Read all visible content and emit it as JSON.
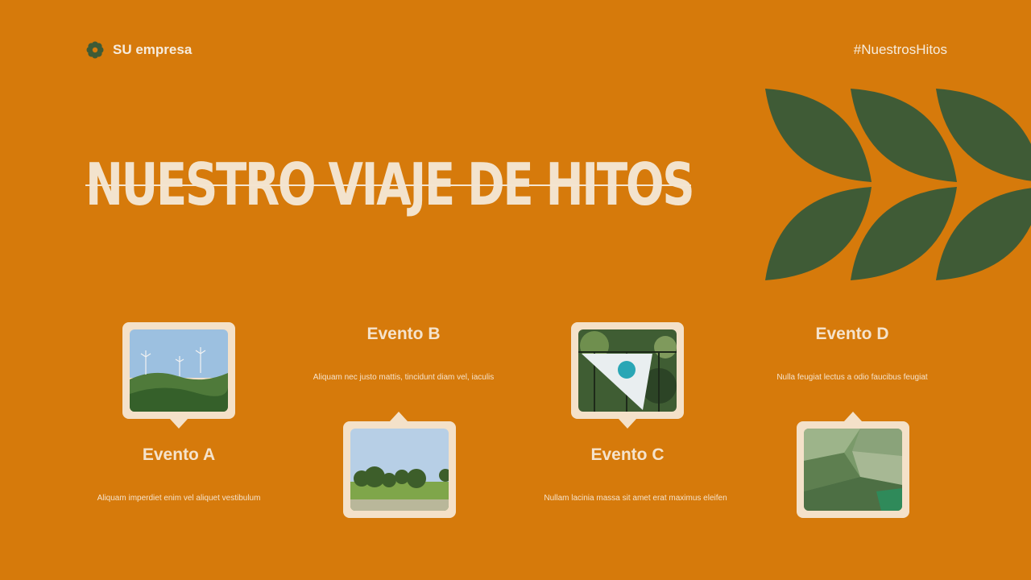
{
  "header": {
    "company": "SU empresa",
    "hashtag": "#NuestrosHitos",
    "logo_icon": "flower-icon"
  },
  "title": "NUESTRO VIAJE DE HITOS",
  "colors": {
    "background": "#d67a0b",
    "leaf": "#3f5b36",
    "card": "#f4e1c9",
    "text": "#f4e5d0"
  },
  "events": [
    {
      "title": "Evento A",
      "description": "Aliquam imperdiet enim vel aliquet vestibulum",
      "image": "wind-turbines-hills-photo"
    },
    {
      "title": "Evento B",
      "description": "Aliquam nec justo mattis, tincidunt diam vel, iaculis",
      "image": "trees-meadow-photo"
    },
    {
      "title": "Evento C",
      "description": "Nullam lacinia massa sit amet erat maximus eleifen",
      "image": "flag-banner-photo"
    },
    {
      "title": "Evento D",
      "description": "Nulla feugiat lectus a odio faucibus feugiat",
      "image": "aerial-fields-photo"
    }
  ]
}
